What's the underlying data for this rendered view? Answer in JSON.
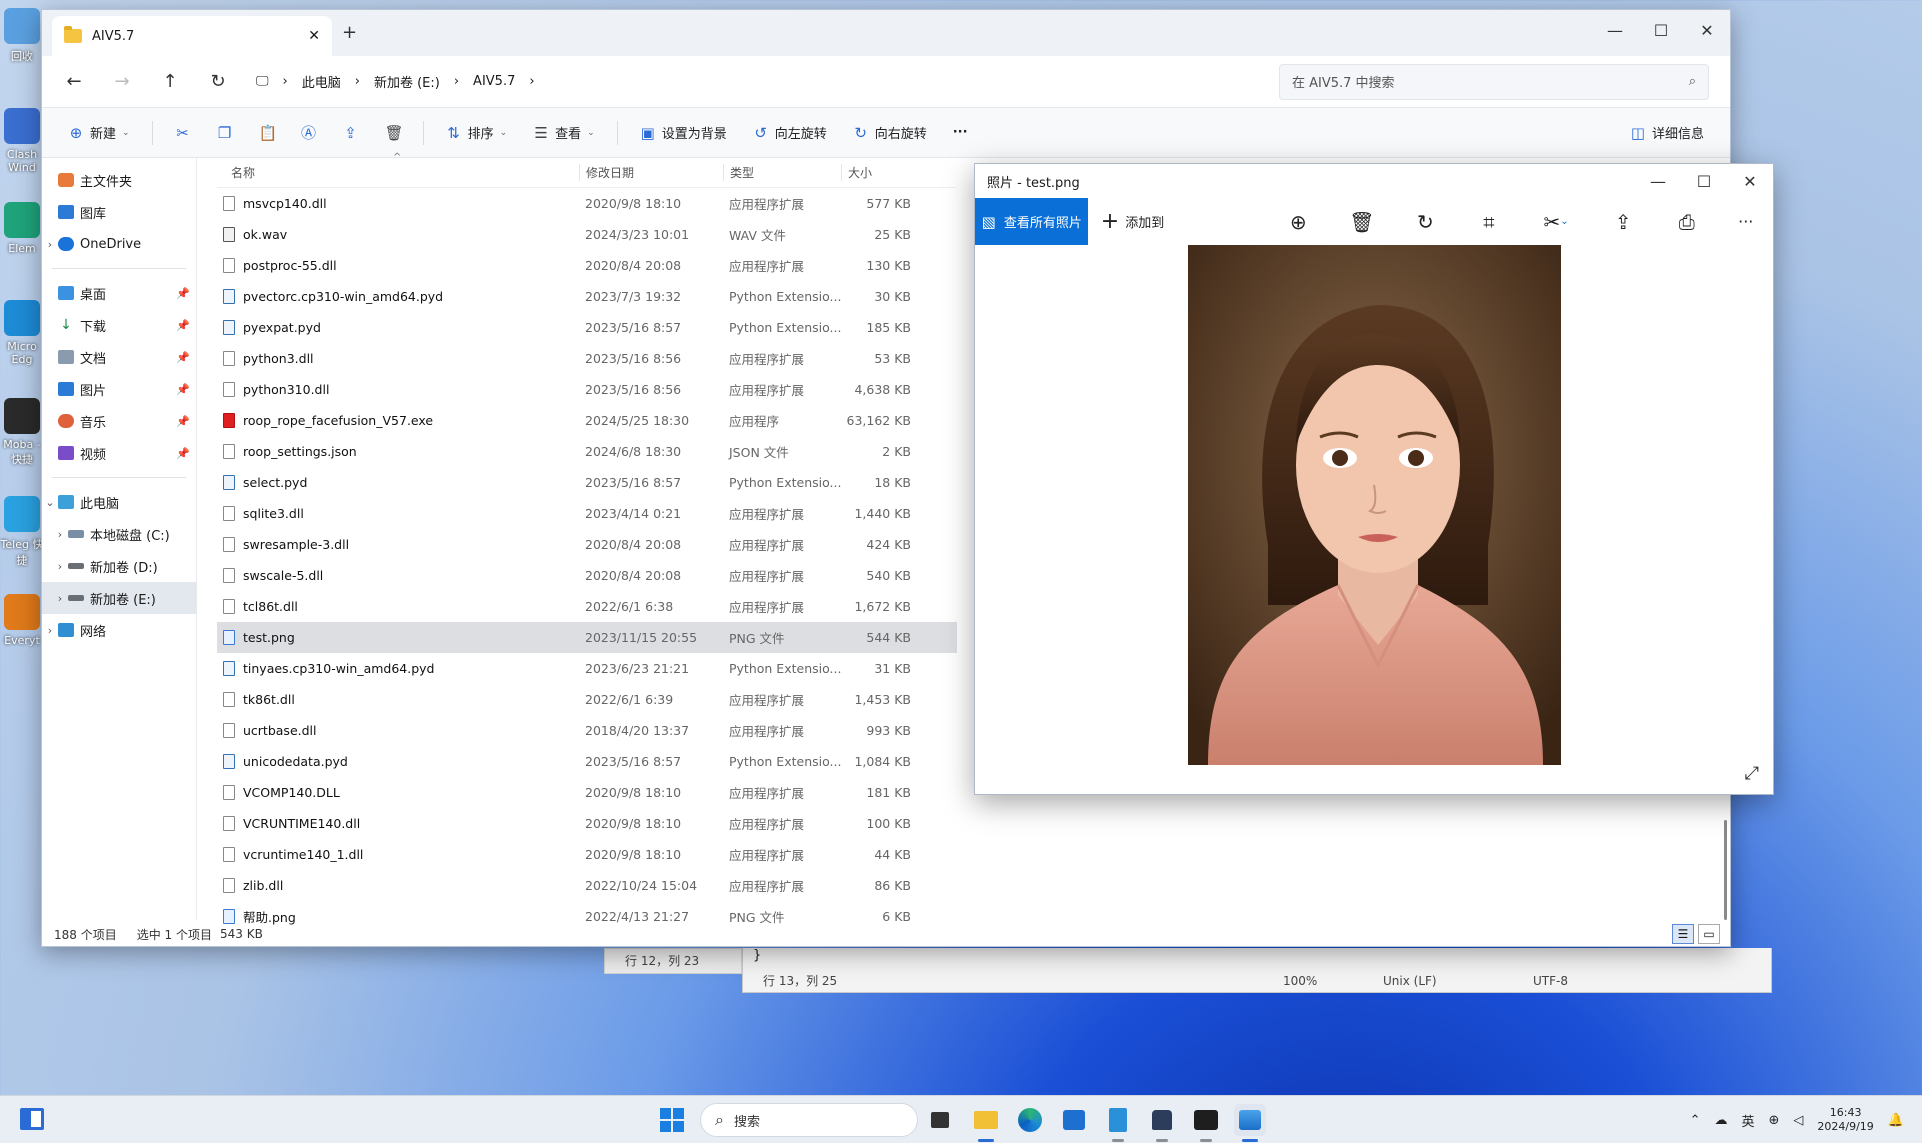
{
  "desktop_icons": [
    {
      "label": "回收",
      "icon": "recycle-bin-icon",
      "color": "#5aa0e0"
    },
    {
      "label": "Clash Wind",
      "icon": "clash-icon",
      "color": "#3a6fd0"
    },
    {
      "label": "Elem",
      "icon": "element-icon",
      "color": "#1ea37a"
    },
    {
      "label": "Micro Edg",
      "icon": "edge-icon",
      "color": "#1d8bd6"
    },
    {
      "label": "Moba - 快捷",
      "icon": "terminal-icon",
      "color": "#2a2a2a"
    },
    {
      "label": "Teleg 快捷",
      "icon": "telegram-icon",
      "color": "#2aa1e0"
    },
    {
      "label": "Everyt",
      "icon": "search-magnifier-icon",
      "color": "#e07a1a"
    }
  ],
  "explorer": {
    "tab_title": "AIV5.7",
    "new_tab": "+",
    "breadcrumb": [
      "此电脑",
      "新加卷 (E:)",
      "AIV5.7"
    ],
    "search_placeholder": "在 AIV5.7 中搜索",
    "commands": {
      "new": "新建",
      "sort": "排序",
      "view": "查看",
      "set_background": "设置为背景",
      "rotate_left": "向左旋转",
      "rotate_right": "向右旋转",
      "more": "···",
      "details": "详细信息"
    },
    "sidebar": {
      "home": "主文件夹",
      "gallery": "图库",
      "onedrive": "OneDrive",
      "desktop": "桌面",
      "downloads": "下载",
      "documents": "文档",
      "pictures": "图片",
      "music": "音乐",
      "videos": "视频",
      "this_pc": "此电脑",
      "drive_c": "本地磁盘 (C:)",
      "drive_d": "新加卷 (D:)",
      "drive_e": "新加卷 (E:)",
      "network": "网络"
    },
    "columns": {
      "name": "名称",
      "date": "修改日期",
      "type": "类型",
      "size": "大小"
    },
    "files": [
      {
        "name": "msvcp140.dll",
        "date": "2020/9/8 18:10",
        "type": "应用程序扩展",
        "size": "577 KB",
        "kind": "file"
      },
      {
        "name": "ok.wav",
        "date": "2024/3/23 10:01",
        "type": "WAV 文件",
        "size": "25 KB",
        "kind": "wav"
      },
      {
        "name": "postproc-55.dll",
        "date": "2020/8/4 20:08",
        "type": "应用程序扩展",
        "size": "130 KB",
        "kind": "file"
      },
      {
        "name": "pvectorc.cp310-win_amd64.pyd",
        "date": "2023/7/3 19:32",
        "type": "Python Extensio...",
        "size": "30 KB",
        "kind": "py"
      },
      {
        "name": "pyexpat.pyd",
        "date": "2023/5/16 8:57",
        "type": "Python Extensio...",
        "size": "185 KB",
        "kind": "py"
      },
      {
        "name": "python3.dll",
        "date": "2023/5/16 8:56",
        "type": "应用程序扩展",
        "size": "53 KB",
        "kind": "file"
      },
      {
        "name": "python310.dll",
        "date": "2023/5/16 8:56",
        "type": "应用程序扩展",
        "size": "4,638 KB",
        "kind": "file"
      },
      {
        "name": "roop_rope_facefusion_V57.exe",
        "date": "2024/5/25 18:30",
        "type": "应用程序",
        "size": "63,162 KB",
        "kind": "exe"
      },
      {
        "name": "roop_settings.json",
        "date": "2024/6/8 18:30",
        "type": "JSON 文件",
        "size": "2 KB",
        "kind": "file"
      },
      {
        "name": "select.pyd",
        "date": "2023/5/16 8:57",
        "type": "Python Extensio...",
        "size": "18 KB",
        "kind": "py"
      },
      {
        "name": "sqlite3.dll",
        "date": "2023/4/14 0:21",
        "type": "应用程序扩展",
        "size": "1,440 KB",
        "kind": "file"
      },
      {
        "name": "swresample-3.dll",
        "date": "2020/8/4 20:08",
        "type": "应用程序扩展",
        "size": "424 KB",
        "kind": "file"
      },
      {
        "name": "swscale-5.dll",
        "date": "2020/8/4 20:08",
        "type": "应用程序扩展",
        "size": "540 KB",
        "kind": "file"
      },
      {
        "name": "tcl86t.dll",
        "date": "2022/6/1 6:38",
        "type": "应用程序扩展",
        "size": "1,672 KB",
        "kind": "file"
      },
      {
        "name": "test.png",
        "date": "2023/11/15 20:55",
        "type": "PNG 文件",
        "size": "544 KB",
        "kind": "img",
        "selected": true
      },
      {
        "name": "tinyaes.cp310-win_amd64.pyd",
        "date": "2023/6/23 21:21",
        "type": "Python Extensio...",
        "size": "31 KB",
        "kind": "py"
      },
      {
        "name": "tk86t.dll",
        "date": "2022/6/1 6:39",
        "type": "应用程序扩展",
        "size": "1,453 KB",
        "kind": "file"
      },
      {
        "name": "ucrtbase.dll",
        "date": "2018/4/20 13:37",
        "type": "应用程序扩展",
        "size": "993 KB",
        "kind": "file"
      },
      {
        "name": "unicodedata.pyd",
        "date": "2023/5/16 8:57",
        "type": "Python Extensio...",
        "size": "1,084 KB",
        "kind": "py"
      },
      {
        "name": "VCOMP140.DLL",
        "date": "2020/9/8 18:10",
        "type": "应用程序扩展",
        "size": "181 KB",
        "kind": "file"
      },
      {
        "name": "VCRUNTIME140.dll",
        "date": "2020/9/8 18:10",
        "type": "应用程序扩展",
        "size": "100 KB",
        "kind": "file"
      },
      {
        "name": "vcruntime140_1.dll",
        "date": "2020/9/8 18:10",
        "type": "应用程序扩展",
        "size": "44 KB",
        "kind": "file"
      },
      {
        "name": "zlib.dll",
        "date": "2022/10/24 15:04",
        "type": "应用程序扩展",
        "size": "86 KB",
        "kind": "file"
      },
      {
        "name": "帮助.png",
        "date": "2022/4/13 21:27",
        "type": "PNG 文件",
        "size": "6 KB",
        "kind": "img"
      }
    ],
    "status": {
      "count": "188 个项目",
      "selected": "选中 1 个项目",
      "size": "543 KB"
    }
  },
  "background_windows": {
    "left_status": "行 12，列 23",
    "brace": "}",
    "notepad_status": {
      "position": "行 13，列 25",
      "zoom": "100%",
      "eol": "Unix (LF)",
      "encoding": "UTF-8"
    }
  },
  "photos": {
    "title": "照片 - test.png",
    "view_all": "查看所有照片",
    "add_to": "添加到"
  },
  "taskbar": {
    "search_label": "搜索",
    "ime": "英",
    "time": "16:43",
    "date": "2024/9/19"
  },
  "colors": {
    "accent": "#0a6fd6",
    "selection": "#dcdee2"
  }
}
